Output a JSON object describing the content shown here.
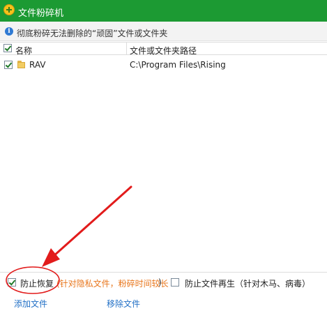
{
  "window": {
    "title": "文件粉碎机",
    "icon": "shredder-app-icon",
    "accent_color": "#1c9a33"
  },
  "infobar": {
    "icon": "info-icon",
    "text": "彻底粉碎无法删除的“顽固”文件或文件夹"
  },
  "list": {
    "columns": [
      {
        "label": "名称"
      },
      {
        "label": "文件或文件夹路径"
      }
    ],
    "select_all_checked": true,
    "rows": [
      {
        "checked": true,
        "icon": "folder-icon",
        "name": "RAV",
        "path": "C:\\Program Files\\Rising"
      }
    ]
  },
  "options": {
    "prevent_recovery": {
      "checked": true,
      "label": "防止恢复",
      "note": "(针对隐私文件，粉碎时间较长",
      "note_close": ")"
    },
    "prevent_regeneration": {
      "checked": false,
      "label": "防止文件再生（针对木马、病毒）"
    }
  },
  "actions": {
    "add_label": "添加文件",
    "remove_label": "移除文件"
  },
  "annotation": {
    "color": "#e21b1b"
  }
}
